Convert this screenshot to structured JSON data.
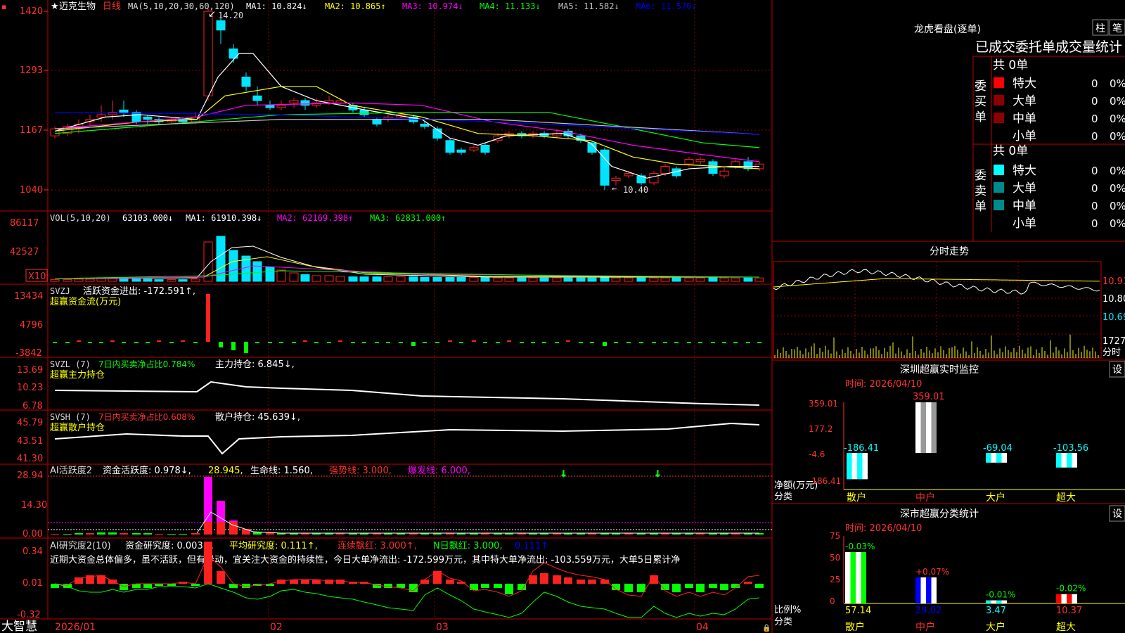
{
  "colors": {
    "up": "#ff2020",
    "down": "#00e5ff",
    "grid": "#8b0000",
    "border": "#c00000",
    "ma1": "#ffffff",
    "ma2": "#ffff00",
    "ma3": "#ff00ff",
    "ma4": "#00ff00",
    "ma5": "#8080ff",
    "ma6": "#0000ff",
    "green": "#00ff00",
    "yellow": "#ffff00",
    "magenta": "#ff00ff",
    "cyan": "#00ffff"
  },
  "stock": {
    "star": "★",
    "name": "迈克生物",
    "period": "日线",
    "ma_label": "MA(5,10,20,30,60,120)",
    "ma": [
      {
        "label": "MA1: 10.824↓",
        "color": "#ffffff"
      },
      {
        "label": "MA2: 10.865↑",
        "color": "#ffff00"
      },
      {
        "label": "MA3: 10.974↓",
        "color": "#ff00ff"
      },
      {
        "label": "MA4: 11.133↓",
        "color": "#00ff00"
      },
      {
        "label": "MA5: 11.582↓",
        "color": "#c0c0c0"
      },
      {
        "label": "MA6: 11.576↓",
        "color": "#0000ff"
      }
    ],
    "high_mark": "14.20",
    "low_mark": "10.40"
  },
  "price_axis": [
    "1420",
    "1293",
    "1167",
    "1040"
  ],
  "vol": {
    "title": "VOL(5,10,20)",
    "value": "63103.000↓",
    "ma1": "MA1: 61910.398↓",
    "ma2": "MA2: 62169.398↑",
    "ma3": "MA3: 62831.000↑",
    "axis": [
      "86117",
      "42527"
    ],
    "unit": "X10"
  },
  "svzj": {
    "title": "SVZJ",
    "desc": "活跃资金进出: -172.591↑,",
    "sub": "超赢资金流(万元)",
    "axis": [
      "13434",
      "4796",
      "-3842"
    ]
  },
  "svzl": {
    "title": "SVZL (7)",
    "desc1": "7日内买卖净占比0.784%",
    "desc2": "主力持仓: 6.845↓,",
    "sub": "超赢主力持仓",
    "axis": [
      "13.69",
      "10.23",
      "6.78"
    ]
  },
  "svsh": {
    "title": "SVSH (7)",
    "desc1": "7日内买卖净占比0.608%",
    "desc2": "散户持仓: 45.639↓,",
    "sub": "超赢散户持仓",
    "axis": [
      "45.79",
      "43.51",
      "41.30"
    ]
  },
  "ai1": {
    "title": "AI活跃度2",
    "d1": "资金活跃度: 0.978↓,",
    "d2": "28.945,",
    "d3": "生命线: 1.560,",
    "d4": "强势线: 3.000,",
    "d5": "爆发线: 6.000,",
    "axis": [
      "28.94",
      "14.30",
      "0.00"
    ]
  },
  "ai2": {
    "title": "AI研究度2(10)",
    "d1": "资金研究度: 0.003↓,",
    "d2": "平均研究度: 0.111↑,",
    "d3": "连续飘红: 3.000↑,",
    "d4": "N日飘红: 3.000,",
    "d5": "0.111↑",
    "comment": "近期大资金总体偏多，虽不活跃，但有异动，宜关注大资金的持续性，今日大单净流出: -172.599万元，其中特大单净流出: -103.559万元，大单5日累计净",
    "axis": [
      "0.34",
      "0.01",
      "-0.32"
    ]
  },
  "dates": [
    "2026/01",
    "02",
    "03",
    "04"
  ],
  "footer": {
    "brand": "大智慧"
  },
  "lhb": {
    "title": "龙虎看盘(逐单)",
    "btn1": "柱",
    "btn2": "笔",
    "tabs": "已成交委托单成交量统计",
    "buy": {
      "side": "委买单",
      "count": "共 0单",
      "rows": [
        {
          "n": "特大",
          "v": "0",
          "p": "0%"
        },
        {
          "n": "大单",
          "v": "0",
          "p": "0%"
        },
        {
          "n": "中单",
          "v": "0",
          "p": "0%"
        },
        {
          "n": "小单",
          "v": "0",
          "p": "0%"
        }
      ]
    },
    "sell": {
      "side": "委卖单",
      "count": "共 0单",
      "rows": [
        {
          "n": "特大",
          "v": "0",
          "p": "0%"
        },
        {
          "n": "大单",
          "v": "0",
          "p": "0%"
        },
        {
          "n": "中单",
          "v": "0",
          "p": "0%"
        },
        {
          "n": "小单",
          "v": "0",
          "p": "0%"
        }
      ]
    }
  },
  "fenshi": {
    "title": "分时走势",
    "axis": [
      "10.91",
      "10.80",
      "10.69"
    ],
    "vol": "1727",
    "vol_label": "分时"
  },
  "monitor": {
    "title": "深圳超赢实时监控",
    "btn": "设",
    "time": "时间: 2026/04/10",
    "axis": [
      "359.01",
      "177.2",
      "-4.6",
      "-186.41"
    ],
    "ylabel": "净额(万元)",
    "xlabel": "分类",
    "bars": [
      {
        "label": "-186.41",
        "cat": "散户",
        "v": -186.41
      },
      {
        "label": "359.01",
        "cat": "中户",
        "v": 359.01
      },
      {
        "label": "-69.04",
        "cat": "大户",
        "v": -69.04
      },
      {
        "label": "-103.56",
        "cat": "超大",
        "v": -103.56
      }
    ]
  },
  "classify": {
    "title": "深市超赢分类统计",
    "btn": "设",
    "time": "时间: 2026/04/10",
    "axis": [
      "75",
      "50",
      "25",
      "0"
    ],
    "ylabel": "比例%",
    "xlabel": "分类",
    "bars": [
      {
        "top": "-0.03%",
        "val": "57.14",
        "cat": "散户",
        "v": 57.14
      },
      {
        "top": "+0.07%",
        "val": "29.02",
        "cat": "中户",
        "v": 29.02
      },
      {
        "top": "-0.01%",
        "val": "3.47",
        "cat": "大户",
        "v": 3.47
      },
      {
        "top": "-0.02%",
        "val": "10.37",
        "cat": "超大",
        "v": 10.37
      }
    ]
  }
}
